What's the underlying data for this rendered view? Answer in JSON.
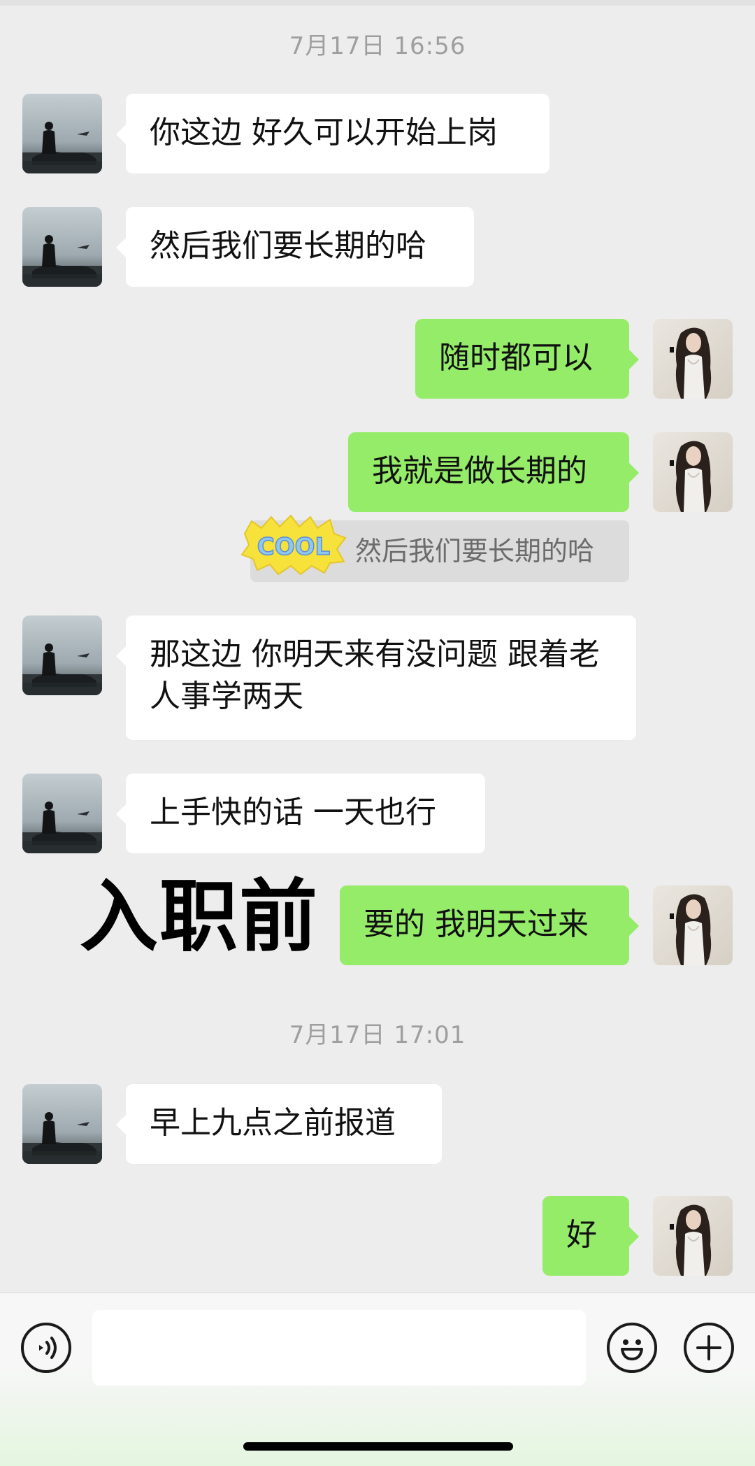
{
  "chat": {
    "timestamps": [
      "7月17日 16:56",
      "7月17日 17:01"
    ],
    "messages": [
      {
        "side": "in",
        "text": "你这边 好久可以开始上岗"
      },
      {
        "side": "in",
        "text": "然后我们要长期的哈"
      },
      {
        "side": "out",
        "text": "随时都可以"
      },
      {
        "side": "out",
        "text": "我就是做长期的"
      },
      {
        "side": "in",
        "text": "那这边 你明天来有没问题 跟着老 人事学两天"
      },
      {
        "side": "in",
        "text": "上手快的话 一天也行"
      },
      {
        "side": "out",
        "text": "要的 我明天过来"
      },
      {
        "side": "in",
        "text": "早上九点之前报道"
      },
      {
        "side": "out",
        "text": "好"
      }
    ],
    "quote": {
      "sticker_text": "COOL",
      "text": "然后我们要长期的哈"
    }
  },
  "overlay": {
    "title": "入职前"
  },
  "input_bar": {
    "voice_icon": "voice-icon",
    "emoji_icon": "emoji-icon",
    "plus_icon": "plus-icon",
    "placeholder": ""
  },
  "colors": {
    "background": "#ededed",
    "outgoing_bubble": "#95ec69",
    "incoming_bubble": "#ffffff",
    "timestamp": "#9e9e9e"
  }
}
